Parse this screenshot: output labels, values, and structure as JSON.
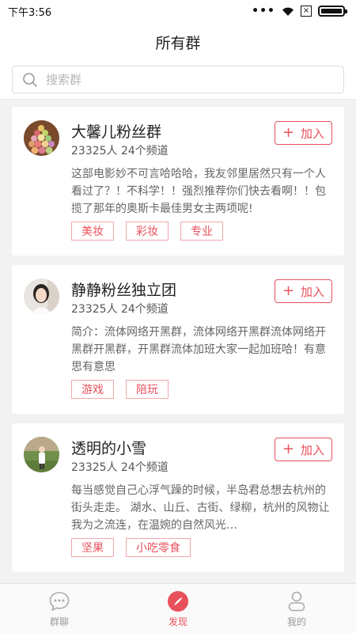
{
  "status": {
    "time": "下午3:56",
    "sim_mark": "×"
  },
  "header": {
    "title": "所有群"
  },
  "search": {
    "placeholder": "搜索群"
  },
  "join_label": "加入",
  "groups": [
    {
      "name": "大馨儿粉丝群",
      "meta": "23325人 24个频道",
      "desc": "这部电影妙不可言哈哈哈，我友邻里居然只有一个人看过了？！不科学！！强烈推荐你们快去看啊！！包揽了那年的奥斯卡最佳男女主两项呢!",
      "tags": [
        "美妆",
        "彩妆",
        "专业"
      ]
    },
    {
      "name": "静静粉丝独立团",
      "meta": "23325人 24个频道",
      "desc": "简介：流体网络开黑群，流体网络开黑群流体网络开黑群开黑群，开黑群流体加班大家一起加班哈！有意思有意思",
      "tags": [
        "游戏",
        "陪玩"
      ]
    },
    {
      "name": "透明的小雪",
      "meta": "23325人 24个频道",
      "desc": "每当感觉自己心浮气躁的时候，半岛君总想去杭州的街头走走。 湖水、山丘、古街、绿柳，杭州的风物让我为之流连，在温婉的自然风光…",
      "tags": [
        "坚果",
        "小吃零食"
      ]
    }
  ],
  "tabbar": {
    "chat": "群聊",
    "discover": "发现",
    "mine": "我的"
  },
  "colors": {
    "accent": "#e8505b"
  }
}
